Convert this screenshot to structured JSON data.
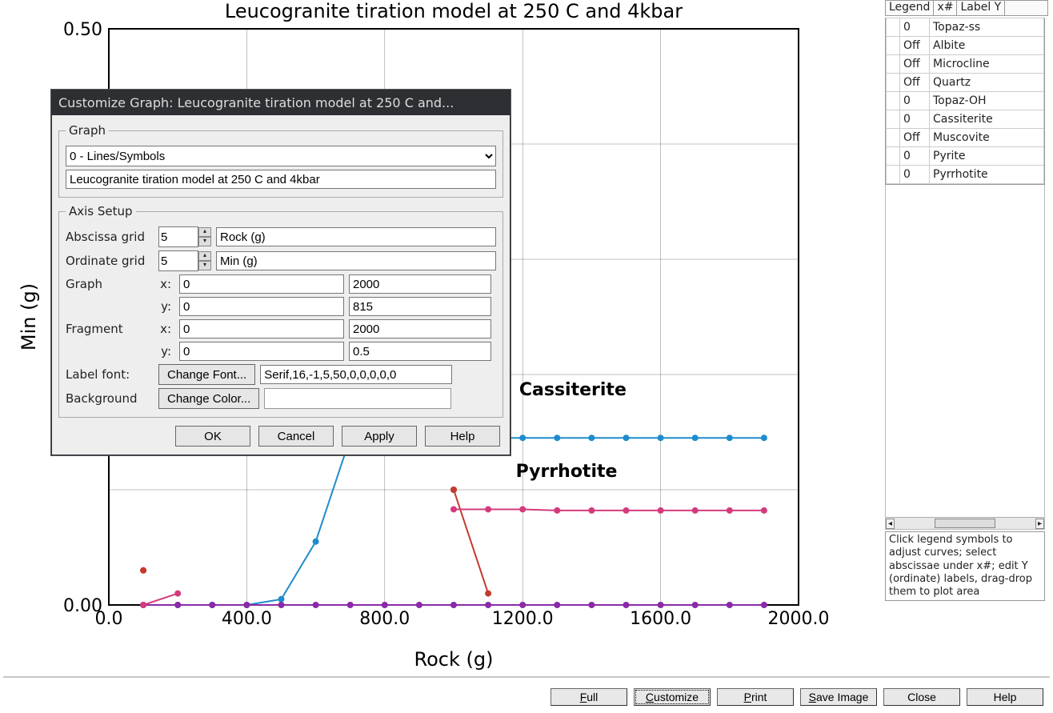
{
  "chart_data": {
    "type": "line",
    "title": "Leucogranite tiration model at 250 C and 4kbar",
    "xlabel": "Rock (g)",
    "ylabel": "Min (g)",
    "xlim": [
      0,
      2000
    ],
    "ylim": [
      0.0,
      0.5
    ],
    "xticks": [
      0.0,
      400.0,
      800.0,
      1200.0,
      1600.0,
      2000.0
    ],
    "yticks": [
      0.0,
      0.5
    ],
    "categories": [
      0,
      100,
      200,
      300,
      400,
      500,
      600,
      700,
      800,
      900,
      1000,
      1100,
      1200,
      1300,
      1400,
      1500,
      1600,
      1700,
      1800,
      1900
    ],
    "series": [
      {
        "name": "Topaz-ss",
        "color": "#c33a2e",
        "values": [
          null,
          0.03,
          null,
          null,
          null,
          null,
          null,
          null,
          null,
          null,
          0.1,
          null,
          null,
          null,
          null,
          null,
          null,
          null,
          null,
          null
        ]
      },
      {
        "name": "Topaz-OH",
        "color": "#c33a2e",
        "values": [
          null,
          0.03,
          null,
          null,
          null,
          null,
          null,
          null,
          null,
          null,
          0.1,
          0.01,
          null,
          null,
          null,
          null,
          null,
          null,
          null,
          null
        ]
      },
      {
        "name": "Cassiterite",
        "color": "#1f8ccc",
        "values": [
          null,
          0.0,
          0.0,
          0.0,
          0.0,
          0.005,
          0.055,
          0.145,
          0.145,
          0.145,
          0.145,
          0.145,
          0.145,
          0.145,
          0.145,
          0.145,
          0.145,
          0.145,
          0.145,
          0.145
        ]
      },
      {
        "name": "Pyrite",
        "color": "#8a2aa8",
        "values": [
          null,
          0.0,
          0.0,
          0.0,
          0.0,
          0.0,
          0.0,
          0.0,
          0.0,
          0.0,
          0.0,
          0.0,
          0.0,
          0.0,
          0.0,
          0.0,
          0.0,
          0.0,
          0.0,
          0.0
        ]
      },
      {
        "name": "Pyrrhotite",
        "color": "#d33b7e",
        "values": [
          null,
          0.0,
          0.01,
          null,
          null,
          null,
          null,
          null,
          null,
          null,
          0.083,
          0.083,
          0.083,
          0.082,
          0.082,
          0.082,
          0.082,
          0.082,
          0.082,
          0.082
        ]
      }
    ],
    "annotations": [
      {
        "text": "Cassiterite",
        "x": 1190,
        "y": 0.182
      },
      {
        "text": "Pyrrhotite",
        "x": 1180,
        "y": 0.111
      }
    ]
  },
  "legend_panel": {
    "headers": [
      "Legend",
      "x#",
      "Label Y"
    ],
    "rows": [
      {
        "x": "0",
        "label": "Topaz-ss"
      },
      {
        "x": "Off",
        "label": "Albite"
      },
      {
        "x": "Off",
        "label": "Microcline"
      },
      {
        "x": "Off",
        "label": "Quartz"
      },
      {
        "x": "0",
        "label": "Topaz-OH"
      },
      {
        "x": "0",
        "label": "Cassiterite"
      },
      {
        "x": "Off",
        "label": "Muscovite"
      },
      {
        "x": "0",
        "label": "Pyrite"
      },
      {
        "x": "0",
        "label": "Pyrrhotite"
      }
    ],
    "hint": "Click legend symbols to adjust curves; select abscissae under x#; edit Y (ordinate) labels, drag-drop them to plot area"
  },
  "bottom_bar": {
    "full": "Full",
    "customize": "Customize",
    "print": "Print",
    "save_image": "Save Image",
    "close": "Close",
    "help": "Help"
  },
  "dialog": {
    "title": "Customize Graph: Leucogranite tiration model at 250 C and...",
    "group_graph": "Graph",
    "dropdown_value": "0 - Lines/Symbols",
    "title_value": "Leucogranite tiration model at 250 C and 4kbar",
    "group_axis": "Axis Setup",
    "abscissa_label": "Abscissa grid",
    "abscissa_value": "5",
    "abscissa_name": "Rock (g)",
    "ordinate_label": "Ordinate grid",
    "ordinate_value": "5",
    "ordinate_name": "Min (g)",
    "graph_label": "Graph",
    "graph_x0": "0",
    "graph_x1": "2000",
    "graph_y0": "0",
    "graph_y1": "815",
    "fragment_label": "Fragment",
    "frag_x0": "0",
    "frag_x1": "2000",
    "frag_y0": "0",
    "frag_y1": "0.5",
    "labelfont_label": "Label font:",
    "change_font": "Change Font...",
    "font_value": "Serif,16,-1,5,50,0,0,0,0,0",
    "background_label": "Background",
    "change_color": "Change Color...",
    "ok": "OK",
    "cancel": "Cancel",
    "apply": "Apply",
    "help": "Help",
    "x_colon": "x:",
    "y_colon": "y:"
  }
}
